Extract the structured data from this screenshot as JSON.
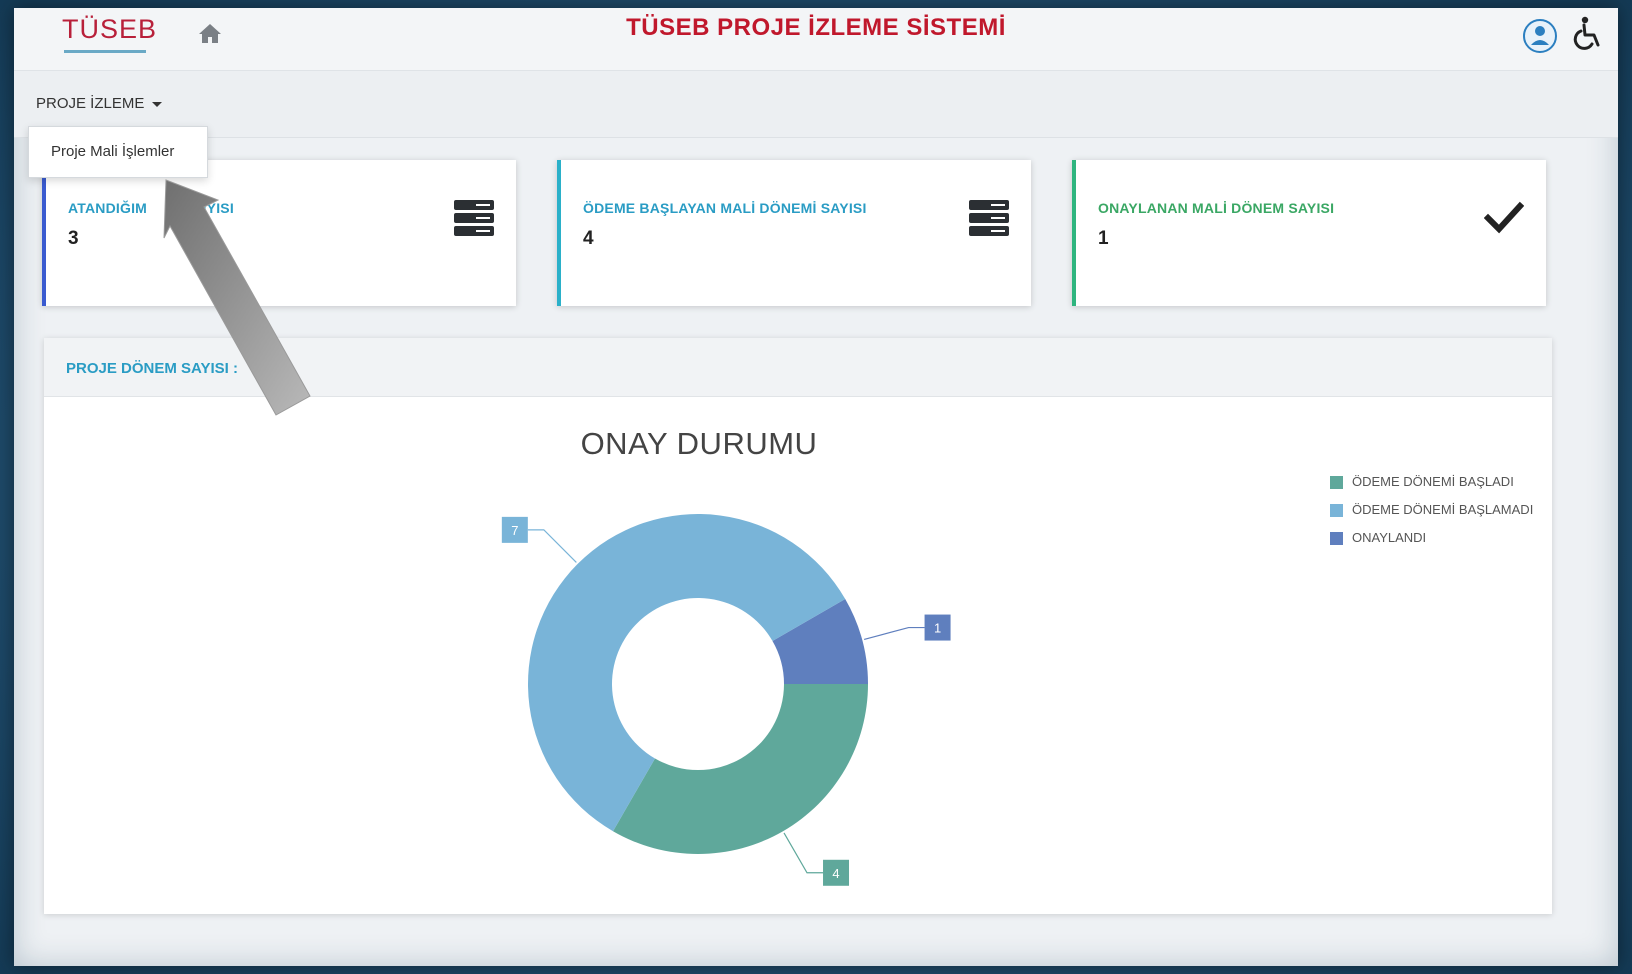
{
  "header": {
    "logo_text": "TÜSEB",
    "app_title": "TÜSEB PROJE İZLEME SİSTEMİ"
  },
  "nav": {
    "menu_label": "PROJE İZLEME",
    "dropdown_items": [
      "Proje Mali İşlemler"
    ]
  },
  "cards": [
    {
      "label": "ATANDIĞIM",
      "label_tail": "SIYISI",
      "value": "3",
      "accent": "#3a5bd0",
      "label_color": "#2a9cc4",
      "icon": "server-stack-icon"
    },
    {
      "label": "ÖDEME BAŞLAYAN MALİ DÖNEMİ SAYISI",
      "value": "4",
      "accent": "#2ab0c9",
      "label_color": "#2a9cc4",
      "icon": "server-stack-icon"
    },
    {
      "label": "ONAYLANAN MALİ DÖNEM SAYISI",
      "value": "1",
      "accent": "#2fb57f",
      "label_color": "#3aa764",
      "icon": "checkmark-icon"
    }
  ],
  "panel": {
    "title": "PROJE DÖNEM SAYISI :"
  },
  "chart_data": {
    "type": "pie",
    "variant": "donut",
    "title": "ONAY DURUMU",
    "categories": [
      "ÖDEME DÖNEMİ BAŞLADI",
      "ÖDEME DÖNEMİ BAŞLAMADI",
      "ONAYLANDI"
    ],
    "values": [
      4,
      7,
      1
    ],
    "colors": [
      "#5fa89b",
      "#79b4d8",
      "#5f7fbe"
    ],
    "data_labels": [
      "4",
      "7",
      "1"
    ],
    "legend_position": "top-right"
  }
}
